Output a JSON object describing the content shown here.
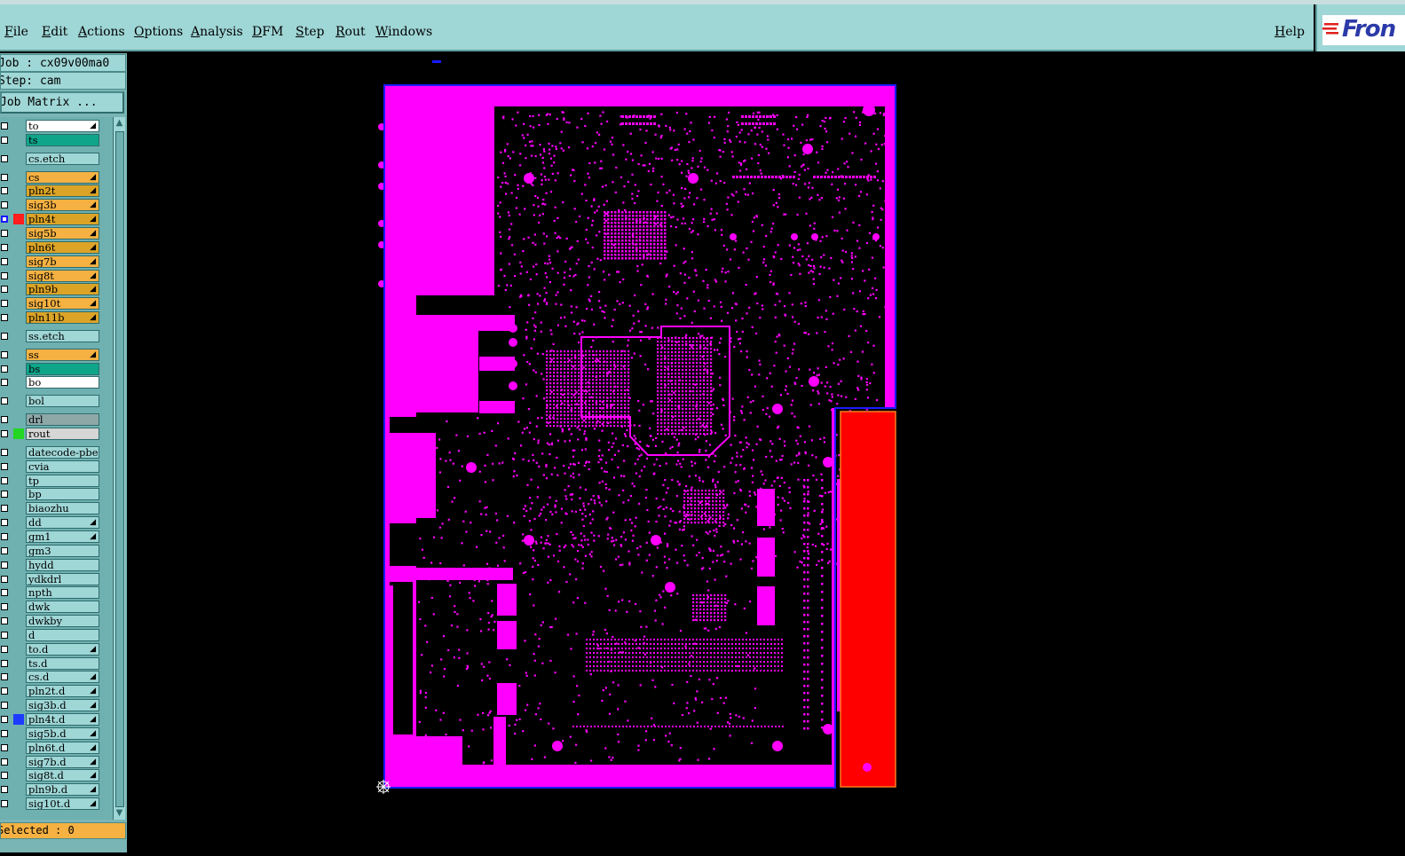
{
  "menubar": {
    "items": [
      "File",
      "Edit",
      "Actions",
      "Options",
      "Analysis",
      "DFM",
      "Step",
      "Rout",
      "Windows"
    ],
    "help": "Help",
    "logo_text": "Fron"
  },
  "job_panel": {
    "job": "Job : cx09v00ma0",
    "step": "Step: cam",
    "job_matrix": "Job Matrix ..."
  },
  "layers": [
    {
      "name": "to",
      "color": "#ffffff",
      "arrow": true
    },
    {
      "name": "ts",
      "color": "#0ea58a",
      "arrow": false
    },
    {
      "name": "cs.etch",
      "color": "#9fd6d6",
      "arrow": false
    },
    {
      "name": "cs",
      "color": "#f5b142",
      "arrow": true
    },
    {
      "name": "pln2t",
      "color": "#dca427",
      "arrow": true
    },
    {
      "name": "sig3b",
      "color": "#f5b142",
      "arrow": true
    },
    {
      "name": "pln4t",
      "color": "#dca427",
      "arrow": true,
      "swatch": "#ff1d1d",
      "highlight": true
    },
    {
      "name": "sig5b",
      "color": "#f5b142",
      "arrow": true
    },
    {
      "name": "pln6t",
      "color": "#dca427",
      "arrow": true
    },
    {
      "name": "sig7b",
      "color": "#f5b142",
      "arrow": true
    },
    {
      "name": "sig8t",
      "color": "#f5b142",
      "arrow": true
    },
    {
      "name": "pln9b",
      "color": "#dca427",
      "arrow": true
    },
    {
      "name": "sig10t",
      "color": "#f5b142",
      "arrow": true
    },
    {
      "name": "pln11b",
      "color": "#dca427",
      "arrow": true
    },
    {
      "name": "ss.etch",
      "color": "#9fd6d6",
      "arrow": false
    },
    {
      "name": "ss",
      "color": "#f5b142",
      "arrow": true
    },
    {
      "name": "bs",
      "color": "#0ea58a",
      "arrow": false
    },
    {
      "name": "bo",
      "color": "#ffffff",
      "arrow": false
    },
    {
      "name": "bol",
      "color": "#9fd6d6",
      "arrow": false
    },
    {
      "name": "drl",
      "color": "#8ea8a8",
      "arrow": false
    },
    {
      "name": "rout",
      "color": "#d6d6d6",
      "arrow": false,
      "swatch": "#22d622"
    },
    {
      "name": "datecode-pbe",
      "color": "#9fd6d6",
      "arrow": false
    },
    {
      "name": "cvia",
      "color": "#9fd6d6",
      "arrow": false
    },
    {
      "name": "tp",
      "color": "#9fd6d6",
      "arrow": false
    },
    {
      "name": "bp",
      "color": "#9fd6d6",
      "arrow": false
    },
    {
      "name": "biaozhu",
      "color": "#9fd6d6",
      "arrow": false
    },
    {
      "name": "dd",
      "color": "#9fd6d6",
      "arrow": true
    },
    {
      "name": "gm1",
      "color": "#9fd6d6",
      "arrow": true
    },
    {
      "name": "gm3",
      "color": "#9fd6d6",
      "arrow": false
    },
    {
      "name": "hydd",
      "color": "#9fd6d6",
      "arrow": false
    },
    {
      "name": "ydkdrl",
      "color": "#9fd6d6",
      "arrow": false
    },
    {
      "name": "npth",
      "color": "#9fd6d6",
      "arrow": false
    },
    {
      "name": "dwk",
      "color": "#9fd6d6",
      "arrow": false
    },
    {
      "name": "dwkby",
      "color": "#9fd6d6",
      "arrow": false
    },
    {
      "name": "d",
      "color": "#9fd6d6",
      "arrow": false
    },
    {
      "name": "to.d",
      "color": "#9fd6d6",
      "arrow": true
    },
    {
      "name": "ts.d",
      "color": "#9fd6d6",
      "arrow": false
    },
    {
      "name": "cs.d",
      "color": "#9fd6d6",
      "arrow": true
    },
    {
      "name": "pln2t.d",
      "color": "#9fd6d6",
      "arrow": true
    },
    {
      "name": "sig3b.d",
      "color": "#9fd6d6",
      "arrow": true
    },
    {
      "name": "pln4t.d",
      "color": "#9fd6d6",
      "arrow": true,
      "swatch": "#1d3bff"
    },
    {
      "name": "sig5b.d",
      "color": "#9fd6d6",
      "arrow": true
    },
    {
      "name": "pln6t.d",
      "color": "#9fd6d6",
      "arrow": true
    },
    {
      "name": "sig7b.d",
      "color": "#9fd6d6",
      "arrow": true
    },
    {
      "name": "sig8t.d",
      "color": "#9fd6d6",
      "arrow": true
    },
    {
      "name": "pln9b.d",
      "color": "#9fd6d6",
      "arrow": true
    },
    {
      "name": "sig10t.d",
      "color": "#9fd6d6",
      "arrow": true
    }
  ],
  "status": {
    "selected": "Selected : 0"
  },
  "canvas": {
    "layer_color": "#ff00ff",
    "profile_color": "#1a1aff",
    "rout_color": "#ff0000"
  }
}
